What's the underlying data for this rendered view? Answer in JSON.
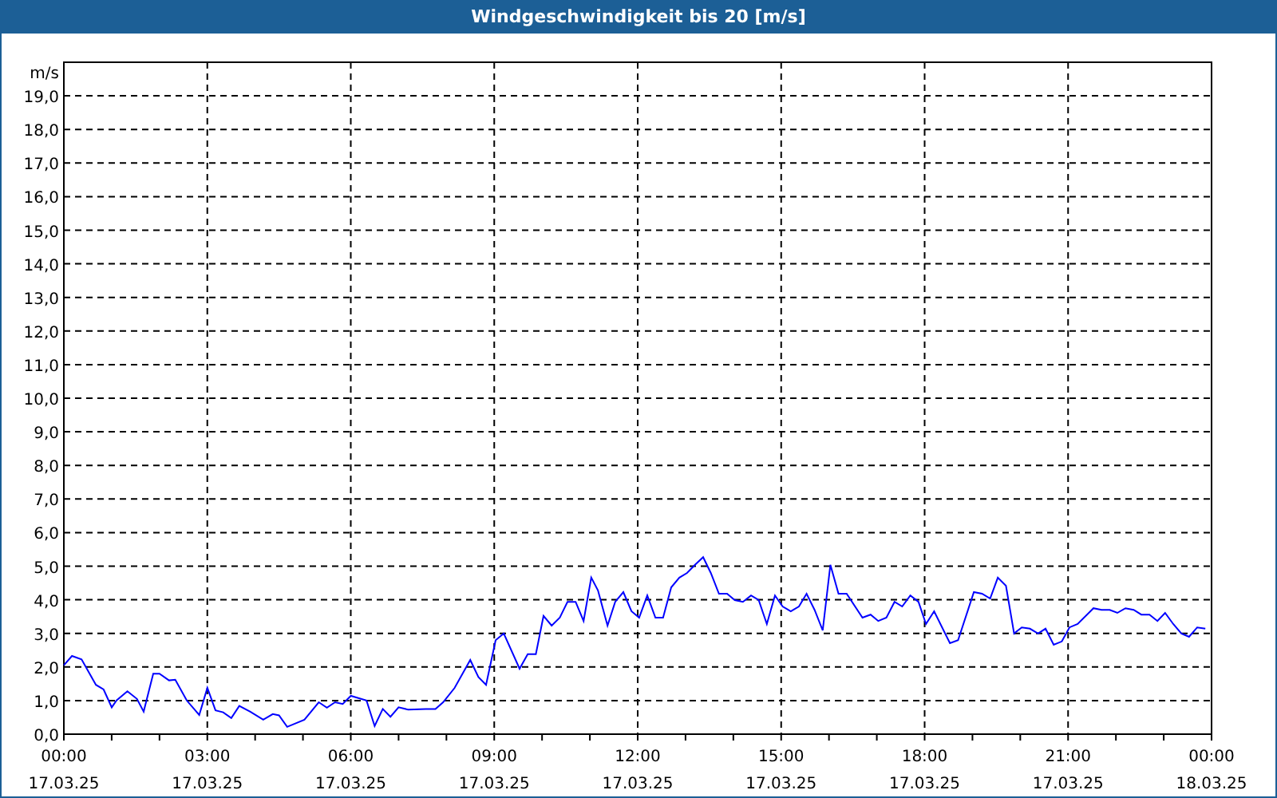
{
  "window": {
    "title": "Windgeschwindigkeit bis 20 [m/s]"
  },
  "chart": {
    "x_dates": [
      "17.03.25",
      "17.03.25",
      "17.03.25",
      "17.03.25",
      "17.03.25",
      "17.03.25",
      "17.03.25",
      "17.03.25",
      "18.03.25"
    ],
    "chart_data": {
      "type": "line",
      "grid": true,
      "ylabel": "m/s",
      "xlim": [
        0,
        24
      ],
      "ylim": [
        0,
        20
      ],
      "xticks": [
        {
          "value": 0,
          "label": "00:00"
        },
        {
          "value": 3,
          "label": "03:00"
        },
        {
          "value": 6,
          "label": "06:00"
        },
        {
          "value": 9,
          "label": "09:00"
        },
        {
          "value": 12,
          "label": "12:00"
        },
        {
          "value": 15,
          "label": "15:00"
        },
        {
          "value": 18,
          "label": "18:00"
        },
        {
          "value": 21,
          "label": "21:00"
        },
        {
          "value": 24,
          "label": "00:00"
        }
      ],
      "yticks": [
        {
          "value": 0,
          "label": "0,0"
        },
        {
          "value": 1,
          "label": "1,0"
        },
        {
          "value": 2,
          "label": "2,0"
        },
        {
          "value": 3,
          "label": "3,0"
        },
        {
          "value": 4,
          "label": "4,0"
        },
        {
          "value": 5,
          "label": "5,0"
        },
        {
          "value": 6,
          "label": "6,0"
        },
        {
          "value": 7,
          "label": "7,0"
        },
        {
          "value": 8,
          "label": "8,0"
        },
        {
          "value": 9,
          "label": "9,0"
        },
        {
          "value": 10,
          "label": "10,0"
        },
        {
          "value": 11,
          "label": "11,0"
        },
        {
          "value": 12,
          "label": "12,0"
        },
        {
          "value": 13,
          "label": "13,0"
        },
        {
          "value": 14,
          "label": "14,0"
        },
        {
          "value": 15,
          "label": "15,0"
        },
        {
          "value": 16,
          "label": "16,0"
        },
        {
          "value": 17,
          "label": "17,0"
        },
        {
          "value": 18,
          "label": "18,0"
        },
        {
          "value": 19,
          "label": "19,0"
        }
      ],
      "x": [
        0,
        0.17,
        0.37,
        0.67,
        0.83,
        1.0,
        1.1,
        1.33,
        1.53,
        1.67,
        1.87,
        2.0,
        2.2,
        2.33,
        2.57,
        2.83,
        3.0,
        3.17,
        3.33,
        3.5,
        3.67,
        3.9,
        4.17,
        4.37,
        4.5,
        4.67,
        5.03,
        5.33,
        5.5,
        5.67,
        5.83,
        6.0,
        6.33,
        6.5,
        6.67,
        6.83,
        7.0,
        7.2,
        7.57,
        7.77,
        7.93,
        8.17,
        8.5,
        8.67,
        8.83,
        9.03,
        9.2,
        9.53,
        9.7,
        9.87,
        10.03,
        10.2,
        10.37,
        10.53,
        10.7,
        10.87,
        11.03,
        11.17,
        11.37,
        11.53,
        11.7,
        11.87,
        12.03,
        12.2,
        12.37,
        12.53,
        12.7,
        12.87,
        13.03,
        13.2,
        13.37,
        13.53,
        13.7,
        13.87,
        14.03,
        14.2,
        14.37,
        14.53,
        14.7,
        14.87,
        15.03,
        15.2,
        15.37,
        15.53,
        15.7,
        15.87,
        16.03,
        16.2,
        16.37,
        16.7,
        16.87,
        17.03,
        17.2,
        17.37,
        17.53,
        17.7,
        17.87,
        18.03,
        18.2,
        18.53,
        18.7,
        19.03,
        19.2,
        19.37,
        19.53,
        19.7,
        19.87,
        20.03,
        20.2,
        20.37,
        20.53,
        20.7,
        20.87,
        21.03,
        21.2,
        21.53,
        21.7,
        21.87,
        22.03,
        22.2,
        22.37,
        22.53,
        22.7,
        22.87,
        23.03,
        23.2,
        23.37,
        23.53,
        23.7,
        23.87
      ],
      "series": [
        {
          "color": "#0000ff",
          "values": [
            2.05,
            2.33,
            2.23,
            1.47,
            1.33,
            0.8,
            1.0,
            1.28,
            1.05,
            0.67,
            1.8,
            1.8,
            1.6,
            1.62,
            1.0,
            0.57,
            1.38,
            0.71,
            0.65,
            0.48,
            0.84,
            0.67,
            0.43,
            0.6,
            0.56,
            0.22,
            0.43,
            0.95,
            0.79,
            0.95,
            0.9,
            1.14,
            1.0,
            0.24,
            0.75,
            0.52,
            0.8,
            0.73,
            0.75,
            0.75,
            0.95,
            1.38,
            2.21,
            1.7,
            1.47,
            2.8,
            3.0,
            1.95,
            2.38,
            2.38,
            3.52,
            3.23,
            3.47,
            3.94,
            3.94,
            3.37,
            4.66,
            4.28,
            3.23,
            3.94,
            4.23,
            3.66,
            3.47,
            4.13,
            3.47,
            3.47,
            4.37,
            4.66,
            4.8,
            5.04,
            5.27,
            4.8,
            4.18,
            4.18,
            3.99,
            3.94,
            4.13,
            3.99,
            3.28,
            4.13,
            3.8,
            3.66,
            3.8,
            4.18,
            3.7,
            3.09,
            5.04,
            4.18,
            4.18,
            3.47,
            3.56,
            3.37,
            3.47,
            3.94,
            3.8,
            4.13,
            3.94,
            3.28,
            3.66,
            2.71,
            2.8,
            4.23,
            4.18,
            4.04,
            4.66,
            4.42,
            3.0,
            3.18,
            3.14,
            3.0,
            3.14,
            2.66,
            2.76,
            3.18,
            3.28,
            3.75,
            3.7,
            3.7,
            3.61,
            3.75,
            3.7,
            3.56,
            3.56,
            3.37,
            3.61,
            3.28,
            3.0,
            2.9,
            3.18,
            3.14
          ]
        }
      ]
    }
  }
}
